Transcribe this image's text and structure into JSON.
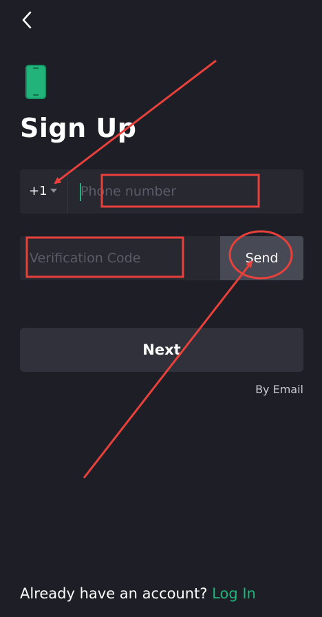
{
  "header": {
    "back_icon": "chevron-left-icon",
    "brand_icon": "smartphone-icon"
  },
  "title": "Sign Up",
  "phone": {
    "country_code": "+1",
    "placeholder": "Phone number"
  },
  "verification": {
    "placeholder": "Verification Code",
    "send_label": "Send"
  },
  "next_label": "Next",
  "by_email_label": "By Email",
  "footer": {
    "prompt": "Already have an account?",
    "login_label": "Log In"
  },
  "colors": {
    "background": "#1e1f26",
    "field": "#272830",
    "accent": "#22b37a",
    "annotation": "#e8413c"
  }
}
